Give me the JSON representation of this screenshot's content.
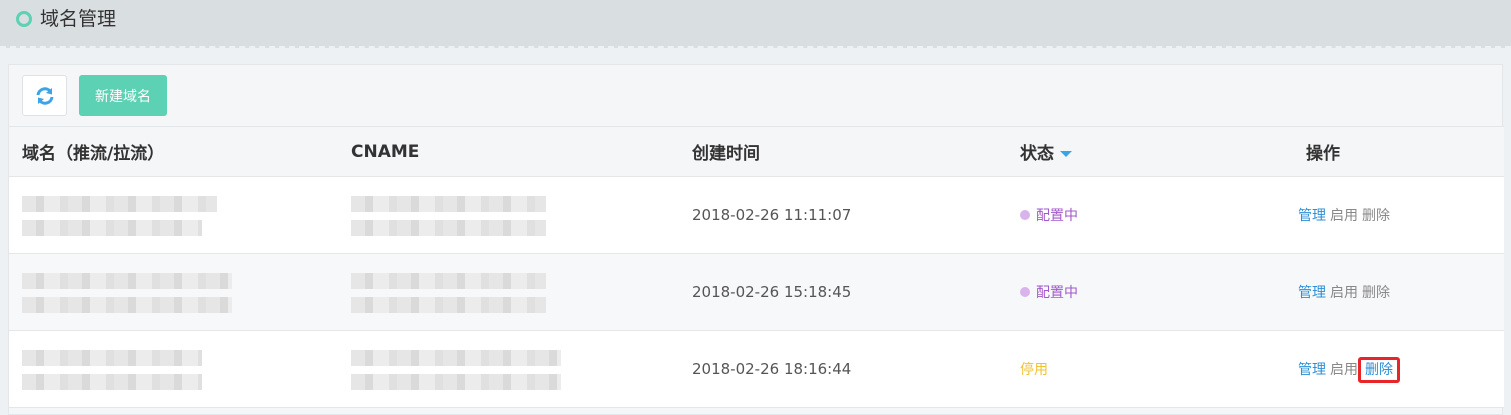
{
  "header": {
    "title": "域名管理",
    "icon": "circle-icon",
    "accent": "#5cd1b3"
  },
  "toolbar": {
    "refresh_icon": "refresh-icon",
    "create_label": "新建域名"
  },
  "table": {
    "columns": {
      "domain": "域名（推流/拉流）",
      "cname": "CNAME",
      "created": "创建时间",
      "status": "状态",
      "ops": "操作"
    },
    "rows": [
      {
        "created": "2018-02-26 11:11:07",
        "status": "配置中",
        "ops": {
          "manage": "管理",
          "enable": "启用",
          "delete": "删除"
        }
      },
      {
        "created": "2018-02-26 15:18:45",
        "status": "配置中",
        "ops": {
          "manage": "管理",
          "enable": "启用",
          "delete": "删除"
        }
      },
      {
        "created": "2018-02-26 18:16:44",
        "status": "停用",
        "ops": {
          "manage": "管理",
          "enable": "启用",
          "delete": "删除"
        }
      }
    ]
  },
  "colors": {
    "link": "#2d8fd6",
    "config_status": "#a259c9",
    "stopped_status": "#f1c232",
    "highlight": "#e8262a"
  }
}
